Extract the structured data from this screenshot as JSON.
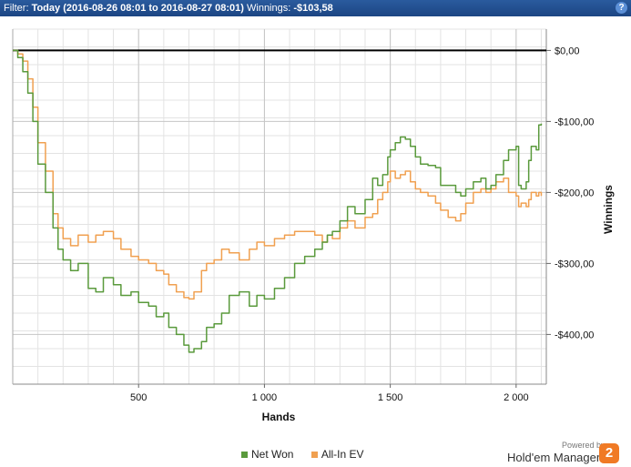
{
  "header": {
    "filter_label": "Filter:",
    "filter_value": "Today (2016-08-26 08:01 to 2016-08-27 08:01)",
    "winnings_label": "Winnings:",
    "winnings_value": "-$103,58",
    "help_label": "?"
  },
  "chart_data": {
    "type": "line",
    "xlabel": "Hands",
    "ylabel": "Winnings",
    "xlim": [
      0,
      2120
    ],
    "ylim": [
      -470,
      30
    ],
    "x_ticks": [
      {
        "value": 500,
        "label": "500"
      },
      {
        "value": 1000,
        "label": "1 000"
      },
      {
        "value": 1500,
        "label": "1 500"
      },
      {
        "value": 2000,
        "label": "2 000"
      }
    ],
    "y_ticks": [
      {
        "value": 0,
        "label": "$0,00"
      },
      {
        "value": -100,
        "label": "-$100,00"
      },
      {
        "value": -200,
        "label": "-$200,00"
      },
      {
        "value": -300,
        "label": "-$300,00"
      },
      {
        "value": -400,
        "label": "-$400,00"
      }
    ],
    "grid": true,
    "legend_position": "bottom",
    "series": [
      {
        "name": "Net Won",
        "color": "#5a9a3c",
        "x": [
          0,
          20,
          40,
          60,
          80,
          100,
          130,
          160,
          180,
          200,
          230,
          260,
          300,
          330,
          360,
          400,
          430,
          470,
          500,
          540,
          570,
          600,
          620,
          650,
          680,
          700,
          720,
          750,
          770,
          800,
          830,
          860,
          900,
          940,
          970,
          1000,
          1040,
          1080,
          1120,
          1160,
          1200,
          1230,
          1250,
          1270,
          1300,
          1330,
          1360,
          1400,
          1430,
          1450,
          1470,
          1490,
          1500,
          1520,
          1540,
          1560,
          1580,
          1600,
          1620,
          1650,
          1680,
          1700,
          1730,
          1760,
          1780,
          1800,
          1830,
          1860,
          1880,
          1900,
          1920,
          1950,
          1970,
          2000,
          2010,
          2020,
          2040,
          2050,
          2060,
          2080,
          2090,
          2100
        ],
        "y": [
          0,
          -10,
          -30,
          -60,
          -100,
          -160,
          -200,
          -250,
          -280,
          -295,
          -310,
          -300,
          -335,
          -340,
          -320,
          -330,
          -345,
          -340,
          -355,
          -360,
          -375,
          -370,
          -390,
          -400,
          -415,
          -425,
          -420,
          -410,
          -390,
          -385,
          -370,
          -345,
          -340,
          -360,
          -345,
          -350,
          -335,
          -320,
          -300,
          -290,
          -280,
          -270,
          -260,
          -255,
          -240,
          -220,
          -230,
          -210,
          -180,
          -190,
          -175,
          -150,
          -140,
          -130,
          -122,
          -125,
          -135,
          -150,
          -160,
          -162,
          -165,
          -190,
          -190,
          -200,
          -205,
          -195,
          -185,
          -180,
          -195,
          -190,
          -175,
          -155,
          -140,
          -135,
          -190,
          -195,
          -185,
          -155,
          -135,
          -140,
          -105,
          -103
        ]
      },
      {
        "name": "All-In EV",
        "color": "#f0a050",
        "x": [
          0,
          20,
          40,
          60,
          80,
          100,
          130,
          160,
          180,
          200,
          230,
          260,
          300,
          330,
          360,
          400,
          430,
          470,
          500,
          540,
          570,
          600,
          620,
          650,
          680,
          700,
          720,
          750,
          770,
          800,
          830,
          860,
          900,
          940,
          970,
          1000,
          1040,
          1080,
          1120,
          1160,
          1200,
          1230,
          1250,
          1270,
          1300,
          1330,
          1360,
          1400,
          1430,
          1450,
          1470,
          1490,
          1500,
          1520,
          1540,
          1560,
          1580,
          1600,
          1620,
          1650,
          1680,
          1700,
          1730,
          1760,
          1780,
          1800,
          1830,
          1860,
          1880,
          1900,
          1920,
          1950,
          1970,
          2000,
          2010,
          2020,
          2040,
          2050,
          2060,
          2080,
          2090,
          2100
        ],
        "y": [
          0,
          -5,
          -15,
          -40,
          -80,
          -130,
          -170,
          -230,
          -250,
          -265,
          -275,
          -260,
          -270,
          -260,
          -255,
          -265,
          -280,
          -290,
          -295,
          -300,
          -310,
          -315,
          -330,
          -340,
          -348,
          -350,
          -340,
          -310,
          -300,
          -295,
          -280,
          -285,
          -295,
          -280,
          -270,
          -275,
          -265,
          -260,
          -255,
          -255,
          -260,
          -270,
          -260,
          -265,
          -250,
          -240,
          -250,
          -235,
          -230,
          -210,
          -200,
          -185,
          -170,
          -180,
          -175,
          -170,
          -185,
          -195,
          -200,
          -205,
          -215,
          -225,
          -235,
          -240,
          -230,
          -215,
          -200,
          -195,
          -200,
          -195,
          -185,
          -180,
          -200,
          -205,
          -220,
          -215,
          -220,
          -210,
          -200,
          -205,
          -200,
          -205
        ]
      }
    ]
  },
  "footer": {
    "legend": [
      {
        "label": "Net Won",
        "color": "#5a9a3c"
      },
      {
        "label": "All-In EV",
        "color": "#f0a050"
      }
    ],
    "powered_by": "Powered by",
    "brand_name": "Hold'em Manager",
    "brand_logo_text": "2"
  }
}
